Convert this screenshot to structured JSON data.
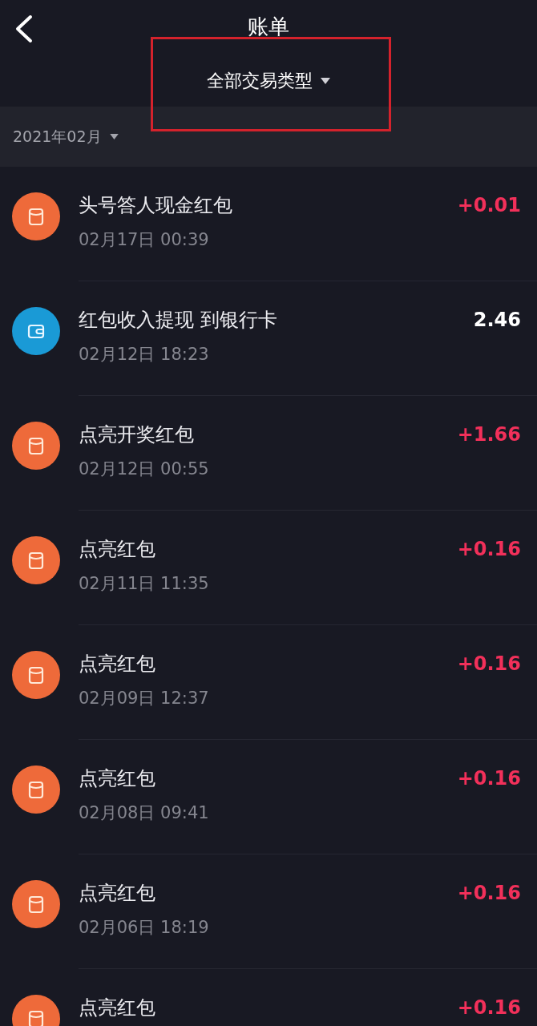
{
  "header": {
    "title": "账单",
    "filter": "全部交易类型",
    "annotation_box": true
  },
  "month_bar": {
    "label": "2021年02月"
  },
  "transactions": [
    {
      "kind": "red_packet",
      "title": "头号答人现金红包",
      "time": "02月17日 00:39",
      "amount": "+0.01"
    },
    {
      "kind": "withdrawal",
      "title": "红包收入提现 到银行卡",
      "time": "02月12日 18:23",
      "amount": "2.46"
    },
    {
      "kind": "red_packet",
      "title": "点亮开奖红包",
      "time": "02月12日 00:55",
      "amount": "+1.66"
    },
    {
      "kind": "red_packet",
      "title": "点亮红包",
      "time": "02月11日 11:35",
      "amount": "+0.16"
    },
    {
      "kind": "red_packet",
      "title": "点亮红包",
      "time": "02月09日 12:37",
      "amount": "+0.16"
    },
    {
      "kind": "red_packet",
      "title": "点亮红包",
      "time": "02月08日 09:41",
      "amount": "+0.16"
    },
    {
      "kind": "red_packet",
      "title": "点亮红包",
      "time": "02月06日 18:19",
      "amount": "+0.16"
    },
    {
      "kind": "red_packet",
      "title": "点亮红包",
      "amount": "+0.16"
    }
  ]
}
